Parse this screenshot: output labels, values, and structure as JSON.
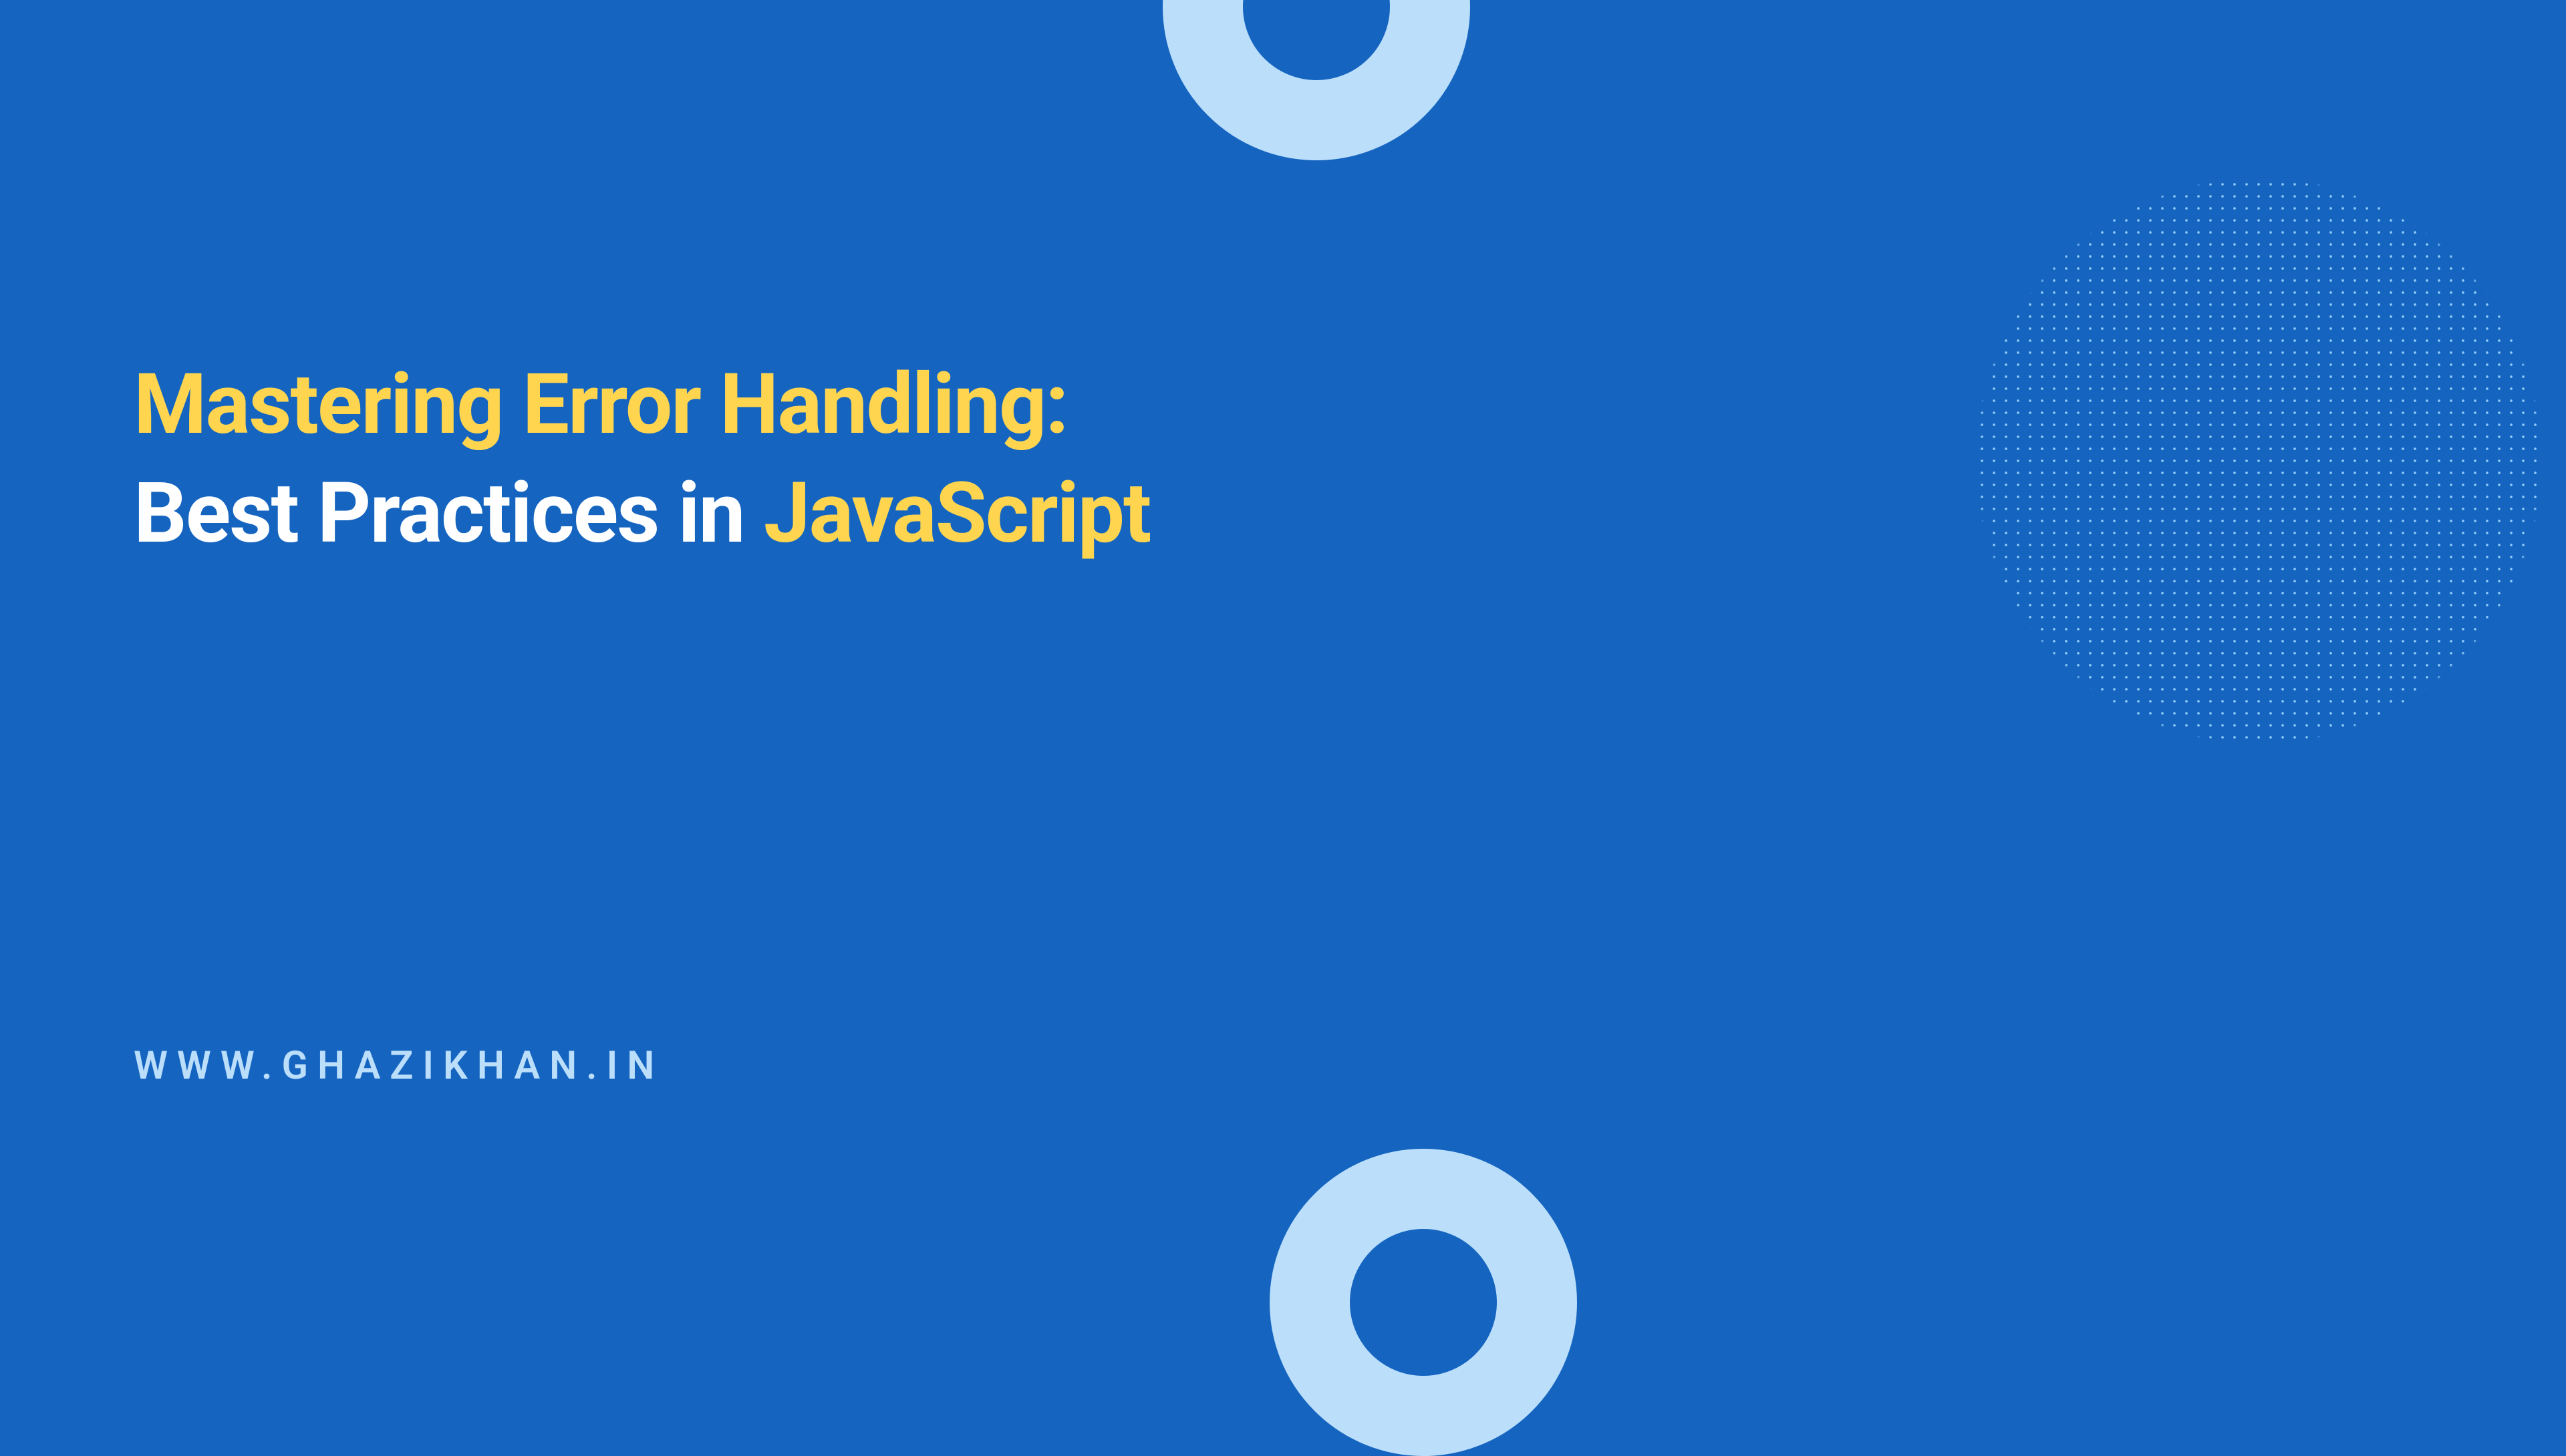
{
  "title": {
    "line1_part1": "Mastering Error Handling:",
    "line2_part1": "Best Practices in ",
    "line2_part2": "JavaScript"
  },
  "website": "WWW.GHAZIKHAN.IN",
  "colors": {
    "background": "#1565C0",
    "yellow": "#FFD54F",
    "white": "#FFFFFF",
    "light_blue": "#BBDEFB",
    "pattern_blue": "#90CAF9"
  }
}
